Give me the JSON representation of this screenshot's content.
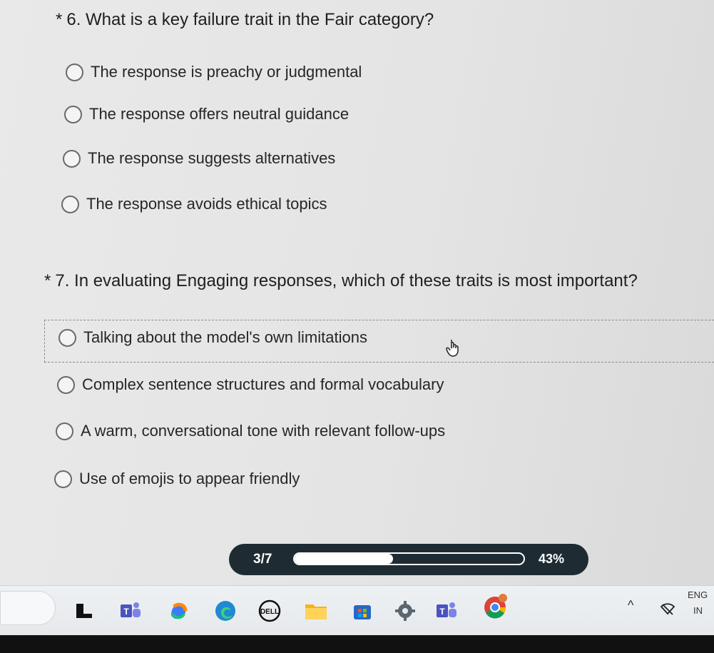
{
  "q6": {
    "star": "*",
    "text": "6. What is a key failure trait in the Fair category?",
    "options": [
      "The response is preachy or judgmental",
      "The response offers neutral guidance",
      "The response suggests alternatives",
      "The response avoids ethical topics"
    ]
  },
  "q7": {
    "star": "*",
    "text": "7. In evaluating Engaging responses, which of these traits is most important?",
    "options": [
      "Talking about the model's own limitations",
      "Complex sentence structures and formal vocabulary",
      "A warm, conversational tone with relevant follow-ups",
      "Use of emojis to appear friendly"
    ]
  },
  "progress": {
    "label": "3/7",
    "percent_text": "43%",
    "fraction": 0.43
  },
  "tray": {
    "lang_top": "ENG",
    "lang_bottom": "IN"
  },
  "taskbar_icons": [
    "file-explorer-icon",
    "teams-icon",
    "copilot-icon",
    "edge-icon",
    "dell-icon",
    "folder-icon",
    "store-icon",
    "settings-icon",
    "teams-icon",
    "chrome-icon"
  ],
  "colors": {
    "progress_bg": "#1f2b33",
    "teams": "#5059c9",
    "edge": "#1f8ad2",
    "folder": "#f2b31e"
  }
}
